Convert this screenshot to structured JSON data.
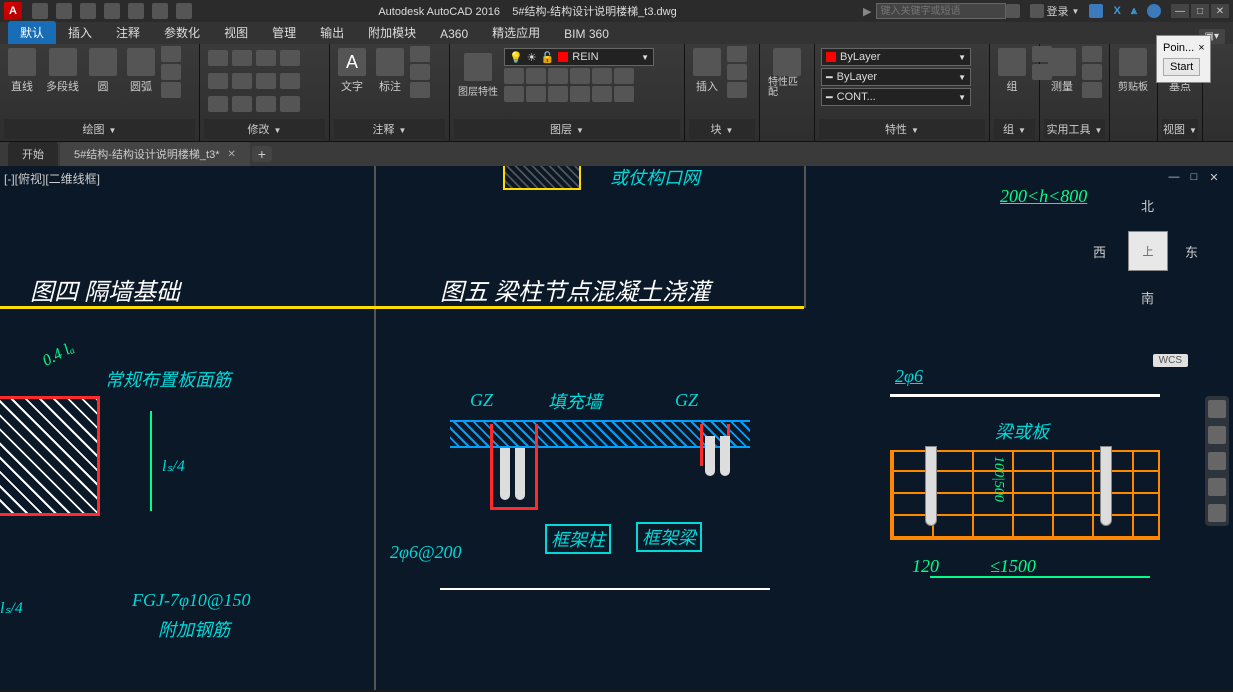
{
  "title": {
    "app_name": "Autodesk AutoCAD 2016",
    "file_name": "5#结构-结构设计说明楼梯_t3.dwg",
    "search_placeholder": "键入关键字或短语",
    "login": "登录"
  },
  "ribbon_tabs": [
    "默认",
    "插入",
    "注释",
    "参数化",
    "视图",
    "管理",
    "输出",
    "附加模块",
    "A360",
    "精选应用",
    "BIM 360"
  ],
  "ribbon_tabs_active": 0,
  "panels": {
    "draw": {
      "title": "绘图",
      "line": "直线",
      "pline": "多段线",
      "circle": "圆",
      "arc": "圆弧"
    },
    "modify": {
      "title": "修改"
    },
    "annotate": {
      "title": "注释",
      "text": "文字",
      "dim": "标注"
    },
    "layers": {
      "title": "图层",
      "props": "图层特性",
      "current": "REIN"
    },
    "block": {
      "title": "块",
      "insert": "插入"
    },
    "match": {
      "title": "特性匹配",
      "label": "特性匹配"
    },
    "props": {
      "title": "特性",
      "color": "ByLayer",
      "ltype": "ByLayer",
      "lweight": "CONT..."
    },
    "group": {
      "title": "组",
      "label": "组"
    },
    "measure": {
      "title": "测量",
      "label": "测量"
    },
    "util": {
      "title": "实用工具"
    },
    "clip": {
      "title": "剪贴板",
      "label": "剪贴板"
    },
    "base": {
      "title": "基点",
      "label": "基点"
    },
    "view": {
      "title": "视图"
    }
  },
  "popup": {
    "line1": "Poin...",
    "close": "×",
    "btn": "Start"
  },
  "file_tabs": {
    "start": "开始",
    "file": "5#结构-结构设计说明楼梯_t3*"
  },
  "canvas": {
    "view_label": "[-][俯视][二维线框]",
    "fig4_title": "图四   隔墙基础",
    "fig5_title": "图五   梁柱节点混凝土浇灌",
    "top_right_dim": "200<h<800",
    "top_note": "或仗构口网",
    "fig4": {
      "n1": "常规布置板面筋",
      "n2": "0.4 lₐ",
      "n3": "lₛ/4",
      "n3b": "lₛ/4",
      "n4": "FGJ-7φ10@150",
      "n5": "附加钢筋"
    },
    "fig5": {
      "gz": "GZ",
      "fill": "填充墙",
      "col": "框架柱",
      "beam": "框架梁",
      "dim": "2φ6@200"
    },
    "fig6": {
      "top": "2φ6",
      "slab": "梁或板",
      "v1": "100|500",
      "d1": "120",
      "d2": "≤1500"
    },
    "viewcube": {
      "n": "北",
      "s": "南",
      "e": "东",
      "w": "西",
      "top": "上"
    },
    "wcs": "WCS"
  }
}
